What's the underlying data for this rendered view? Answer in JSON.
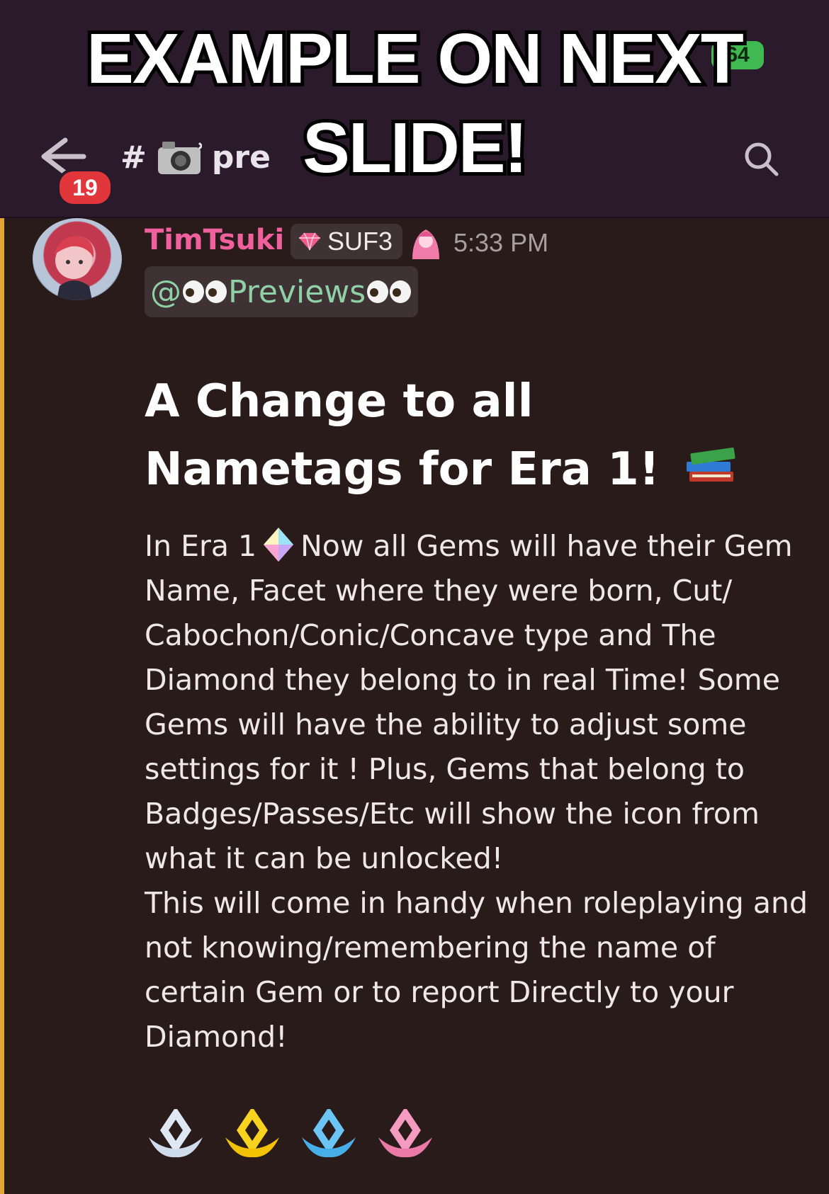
{
  "overlay_caption": {
    "line1": "EXAMPLE ON NEXT",
    "line2": "SLIDE!"
  },
  "status_bar": {
    "battery": "64"
  },
  "header": {
    "unread_count": "19",
    "channel_prefix": "#",
    "channel_name_visible": "pre",
    "icons": [
      "back-arrow-icon",
      "camera-icon",
      "search-icon"
    ]
  },
  "message": {
    "author": "TimTsuki",
    "tag": "SUF3",
    "timestamp": "5:33 PM",
    "mention": "@👀Previews👀",
    "mention_parts": {
      "at": "@",
      "text": "Previews"
    },
    "title": "A Change to all Nametags for Era 1!",
    "body_part1": "In Era 1",
    "body_part2": "Now all Gems will have their Gem Name, Facet where they were born, Cut/ Cabochon/Conic/Concave type and The Diamond they belong to in real Time! Some Gems will have the ability to adjust some settings for it ! Plus, Gems that belong to Badges/Passes/Etc will show the icon from what it can be unlocked!",
    "body_part3": "This will come in handy when roleplaying and not knowing/remembering the name of certain Gem or to report Directly to your Diamond!",
    "reaction_icons": [
      "white-diamond-hands-icon",
      "yellow-diamond-hands-icon",
      "blue-diamond-hands-icon",
      "pink-diamond-hands-icon"
    ]
  },
  "colors": {
    "author": "#f0609d",
    "mention": "#8fd0a6",
    "accent_bar": "#e3a436",
    "unread_badge": "#e2363d"
  }
}
